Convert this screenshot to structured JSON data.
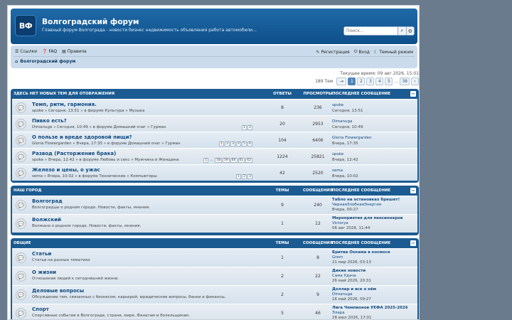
{
  "header": {
    "logo_text": "ВФ",
    "title": "Волгоградский форум",
    "description": "Главный форум Волгограда - новости бизнес недвижимость объявления работа автомобили...",
    "search_placeholder": "Поиск…"
  },
  "nav": {
    "links": "Ссылки",
    "faq": "FAQ",
    "rules": "Правила",
    "register": "Регистрация",
    "login": "Вход",
    "dark_mode": "Темный режим",
    "breadcrumb": "Волгоградский форум"
  },
  "current_time": "Текущее время: 09 авг 2026, 15:01",
  "pagination": {
    "topics": "189 Тем",
    "pages": [
      "1",
      "2",
      "3",
      "4",
      "5",
      "…",
      "38"
    ],
    "current": "1"
  },
  "topics_section": {
    "title": "ЗДЕСЬ НЕТ НОВЫХ ТЕМ ДЛЯ ОТОБРАЖЕНИЯ",
    "col_replies": "ОТВЕТЫ",
    "col_views": "ПРОСМОТРЫ",
    "col_last": "ПОСЛЕДНЕЕ СООБЩЕНИЕ",
    "rows": [
      {
        "title": "Темп, ритм, гармония.",
        "sub": "spoke » Сегодня, 13:51 » в форуме Культура » Музыка",
        "replies": "8",
        "views": "236",
        "last_user": "spoke",
        "last_time": "Сегодня, 13:51",
        "pages": []
      },
      {
        "title": "Пивко есть?",
        "sub": "Dimanuga » Сегодня, 10:49 » в форуме Домашний очаг » Гурман",
        "replies": "20",
        "views": "2953",
        "last_user": "Dimanuga",
        "last_time": "Сегодня, 10:49",
        "pages": [
          "1",
          "2"
        ]
      },
      {
        "title": "О пользе и вреде здоровой пищи?",
        "sub": "Gloria Flowergarden » Вчера, 17:35 » в форуме Домашний очаг » Гурман",
        "replies": "104",
        "views": "6406",
        "last_user": "Gloria Flowergarden",
        "last_time": "Вчера, 17:35",
        "pages": [
          "1",
          "2",
          "3",
          "4",
          "5",
          "6"
        ]
      },
      {
        "title": "Развод (Расторжение брака)",
        "sub": "spoke » Вчера, 12:42 » в форуме Любовь и секс » Мужчина и Женщина",
        "replies": "1224",
        "views": "25821",
        "last_user": "spoke",
        "last_time": "Вчера, 12:42",
        "pages": [
          "1",
          "…",
          "58",
          "59",
          "60",
          "61",
          "62"
        ]
      },
      {
        "title": "Железо и цены, о ужас",
        "sub": "sema » Вчера, 10:02 » в форуме Технические » Компьютеры",
        "replies": "42",
        "views": "2520",
        "last_user": "sema",
        "last_time": "Вчера, 10:02",
        "pages": [
          "1",
          "2",
          "3"
        ]
      }
    ]
  },
  "city_section": {
    "title": "НАШ ГОРОД",
    "col_topics": "ТЕМЫ",
    "col_posts": "СООБЩЕНИЯ",
    "col_last": "ПОСЛЕДНЕЕ СООБЩЕНИЕ",
    "rows": [
      {
        "title": "Волгоград",
        "sub": "Волгоградцы о родном городе. Новости, факты, мнения.",
        "topics": "9",
        "posts": "240",
        "last_title": "Табло на остановках брешет!",
        "last_user": "ЧернаяЗлобнаяЭнергия",
        "last_time": "Вчера, 00:27"
      },
      {
        "title": "Волжский",
        "sub": "Волжане о родном городе. Новости, факты, мнения.",
        "topics": "1",
        "posts": "12",
        "last_title": "Мероприятия для пенсионеров",
        "last_user": "Victorya",
        "last_time": "06 авг 2026, 11:44"
      }
    ]
  },
  "general_section": {
    "title": "ОБЩИЕ",
    "col_topics": "ТЕМЫ",
    "col_posts": "СООБЩЕНИЯ",
    "col_last": "ПОСЛЕДНЕЕ СООБЩЕНИЕ",
    "rows": [
      {
        "title": "Статьи",
        "sub": "Статьи на разные тематики",
        "topics": "1",
        "posts": "8",
        "last_title": "Бритва Оккама в космосе",
        "last_user": "Grem",
        "last_time": "21 мар 2026, 03:13"
      },
      {
        "title": "О жизни",
        "sub": "Отношение людей к сегодняшней жизни.",
        "topics": "2",
        "posts": "22",
        "last_title": "Дикие новости",
        "last_user": "Сама Удача",
        "last_time": "26 май 2026, 20:31"
      },
      {
        "title": "Деловые вопросы",
        "sub": "Обсуждение тем, связанных с бизнесом, карьерой, юридические вопросы, банки и финансы.",
        "topics": "2",
        "posts": "9",
        "last_title": "Доллар и все о нём",
        "last_user": "Dimanuga",
        "last_time": "16 май 2026, 09:27"
      },
      {
        "title": "Спорт",
        "sub": "Спортивные события в Волгограде, стране, мире. Фанатам и болельщикам.",
        "topics": "5",
        "posts": "46",
        "last_title": "Лига Чемпионов УЕФА 2025-2026",
        "last_user": "Элара",
        "last_time": "28 июл 2026, 17:01"
      }
    ]
  }
}
